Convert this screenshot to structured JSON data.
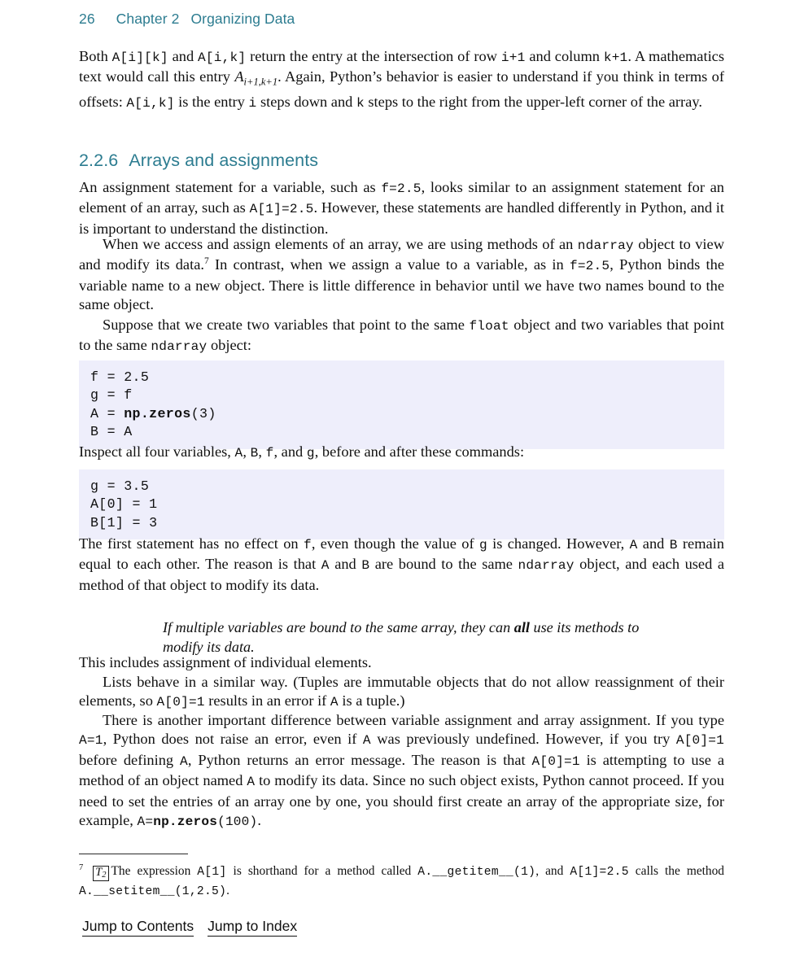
{
  "running_head": {
    "page_number": "26",
    "chapter_label": "Chapter 2",
    "chapter_title": "Organizing Data"
  },
  "colors": {
    "heading_teal": "#2c7c90",
    "code_background": "#eeeefb",
    "body_text": "#101010"
  },
  "paragraphs": {
    "p1": {
      "s1": "Both ",
      "c1": "A[i][k]",
      "s2": " and ",
      "c2": "A[i,k]",
      "s3": " return the entry at the intersection of row ",
      "c3": "i+1",
      "s4": " and column ",
      "c4": "k+1",
      "s5": ". A mathematics text would call this entry ",
      "math": "A",
      "math_sub": "i+1,k+1",
      "s6": ". Again, Python’s behavior is easier to understand if you think in terms of offsets: ",
      "c5": "A[i,k]",
      "s7": " is the entry ",
      "c6": "i",
      "s8": " steps down and ",
      "c7": "k",
      "s9": " steps to the right from the upper-left corner of the array."
    },
    "p2": {
      "s1": "An assignment statement for a variable, such as ",
      "c1": "f=2.5",
      "s2": ", looks similar to an assignment statement for an element of an array, such as ",
      "c2": "A[1]=2.5",
      "s3": ". However, these statements are handled differently in Python, and it is important to understand the distinction."
    },
    "p3": {
      "s1": "When we access and assign elements of an array, we are using methods of an ",
      "c1": "ndarray",
      "s2": " object to view and modify its data.",
      "footnote_mark": "7",
      "s3": " In contrast, when we assign a value to a variable, as in ",
      "c2": "f=2.5",
      "s4": ", Python binds the variable name to a new object. There is little difference in behavior until we have two names bound to the same object."
    },
    "p4": {
      "s1": "Suppose that we create two variables that point to the same ",
      "c1": "float",
      "s2": " object and two variables that point to the same ",
      "c2": "ndarray",
      "s3": " object:"
    },
    "p5": {
      "s1": "Inspect all four variables, ",
      "c1": "A",
      "s2": ", ",
      "c2": "B",
      "s3": ", ",
      "c3": "f",
      "s4": ", and ",
      "c4": "g",
      "s5": ", before and after these commands:"
    },
    "p6": {
      "s1": "The first statement has no effect on ",
      "c1": "f",
      "s2": ", even though the value of ",
      "c2": "g",
      "s3": " is changed. However, ",
      "c3": "A",
      "s4": " and ",
      "c4": "B",
      "s5": " remain equal to each other. The reason is that ",
      "c5": "A",
      "s6": " and ",
      "c6": "B",
      "s7": " are bound to the same ",
      "c7": "ndarray",
      "s8": " object, and each used a method of that object to modify its data."
    },
    "p7": {
      "s1": "This includes assignment of individual elements."
    },
    "p8": {
      "s1": "Lists behave in a similar way. (Tuples are immutable objects that do not allow reassignment of their elements, so ",
      "c1": "A[0]=1",
      "s2": " results in an error if ",
      "c2": "A",
      "s3": " is a tuple.)"
    },
    "p9": {
      "s1": "There is another important difference between variable assignment and array assignment. If you type ",
      "c1": "A=1",
      "s2": ", Python does not raise an error, even if ",
      "c2": "A",
      "s3": " was previously undefined. However, if you try ",
      "c3": "A[0]=1",
      "s4": " before defining ",
      "c4": "A",
      "s5": ", Python returns an error message. The reason is that ",
      "c5": "A[0]=1",
      "s6": " is attempting to use a method of an object named ",
      "c6": "A",
      "s7": " to modify its data. Since no such object exists, Python cannot proceed. If you need to set the entries of an array one by one, you should first create an array of the appropriate size, for example, ",
      "c7a": "A=",
      "c7b": "np.zeros",
      "c7c": "(100)",
      "s8": "."
    }
  },
  "section_heading": {
    "number": "2.2.6",
    "title": "Arrays and assignments"
  },
  "code_block_1": {
    "lines": [
      {
        "plain": "f = 2.5"
      },
      {
        "plain": "g = f"
      },
      {
        "pre": "A = ",
        "bold": "np.zeros",
        "post": "(3)"
      },
      {
        "plain": "B = A"
      }
    ]
  },
  "code_block_2": {
    "lines": [
      {
        "plain": "g = 3.5"
      },
      {
        "plain": "A[0] = 1"
      },
      {
        "plain": "B[1] = 3"
      }
    ]
  },
  "callout": {
    "before": "If multiple variables are bound to the same array, they can ",
    "bold": "all",
    "after": " use its methods to modify its data."
  },
  "footnote": {
    "marker": "7",
    "tag_letter": "T",
    "tag_sub": "2",
    "s1": "The expression ",
    "c1": "A[1]",
    "s2": " is shorthand for a method called ",
    "c2": "A.__getitem__(1)",
    "s3": ", and ",
    "c3": "A[1]=2.5",
    "s4": " calls the method ",
    "c4": "A.__setitem__(1,2.5)",
    "s5": "."
  },
  "nav_links": {
    "contents": "Jump to Contents",
    "index": "Jump to Index"
  }
}
